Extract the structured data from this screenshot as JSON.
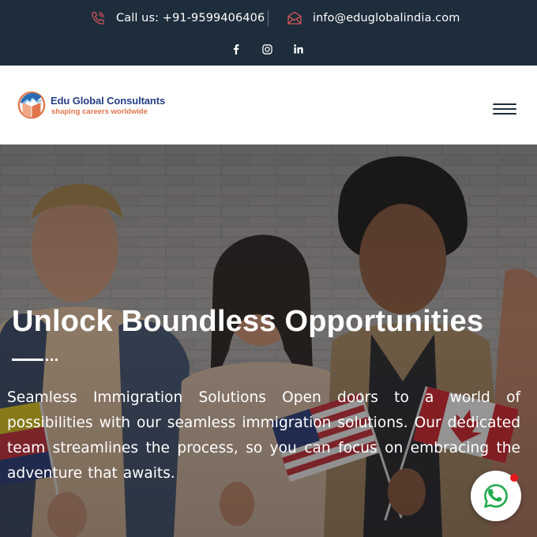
{
  "topbar": {
    "phone_text": "Call us: +91-9599406406",
    "email_text": "info@eduglobalindia.com",
    "phone_icon": "phone-icon",
    "email_icon": "mail-icon",
    "social": [
      {
        "name": "facebook",
        "icon": "facebook-icon"
      },
      {
        "name": "instagram",
        "icon": "instagram-icon"
      },
      {
        "name": "linkedin",
        "icon": "linkedin-icon"
      }
    ],
    "background_color": "#1e2d3b",
    "icon_accent_color": "#e05a5a"
  },
  "header": {
    "logo_name": "Edu Global Consultants",
    "logo_tagline": "shaping careers worldwide",
    "menu_icon": "hamburger-menu-icon"
  },
  "hero": {
    "title": "Unlock Boundless Opportunities",
    "description": "Seamless Immigration Solutions Open doors to a world of possibilities with our seamless immigration solutions. Our dedicated team streamlines the process, so you can focus on embracing the adventure that awaits."
  },
  "floating": {
    "whatsapp_icon": "whatsapp-icon",
    "whatsapp_color": "#1faa4b",
    "notification_color": "#e8181c"
  }
}
